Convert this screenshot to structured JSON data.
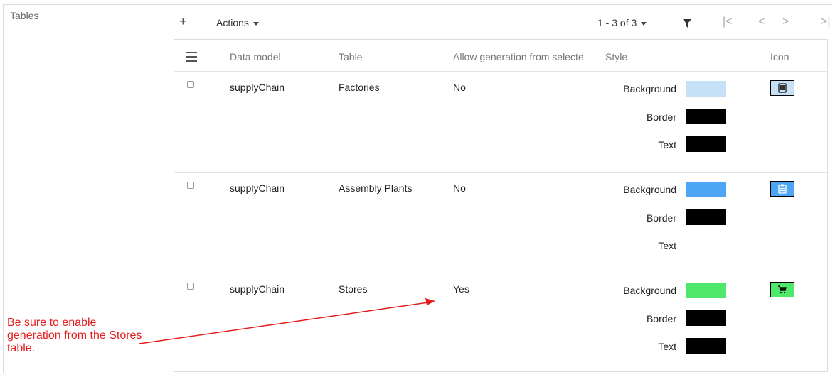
{
  "section": {
    "label": "Tables"
  },
  "toolbar": {
    "add_label": "+",
    "actions_label": "Actions",
    "pager_label": "1 - 3 of 3"
  },
  "columns": {
    "data_model": "Data model",
    "table": "Table",
    "allow_generation": "Allow generation from selecte",
    "style": "Style",
    "icon": "Icon"
  },
  "style_labels": {
    "background": "Background",
    "border": "Border",
    "text": "Text"
  },
  "rows": [
    {
      "data_model": "supplyChain",
      "table": "Factories",
      "allow_generation": "No",
      "background_color": "#c6e0f8",
      "border_color": "#000000",
      "text_color": "#000000",
      "icon": "factory-icon"
    },
    {
      "data_model": "supplyChain",
      "table": "Assembly Plants",
      "allow_generation": "No",
      "background_color": "#4da6f5",
      "border_color": "#000000",
      "text_color": "#ffffff",
      "icon": "clipboard-icon"
    },
    {
      "data_model": "supplyChain",
      "table": "Stores",
      "allow_generation": "Yes",
      "background_color": "#4ee86a",
      "border_color": "#000000",
      "text_color": "#000000",
      "icon": "cart-icon"
    }
  ],
  "annotation": {
    "text": "Be sure to enable generation from the Stores table.",
    "color": "#e41e1e"
  }
}
